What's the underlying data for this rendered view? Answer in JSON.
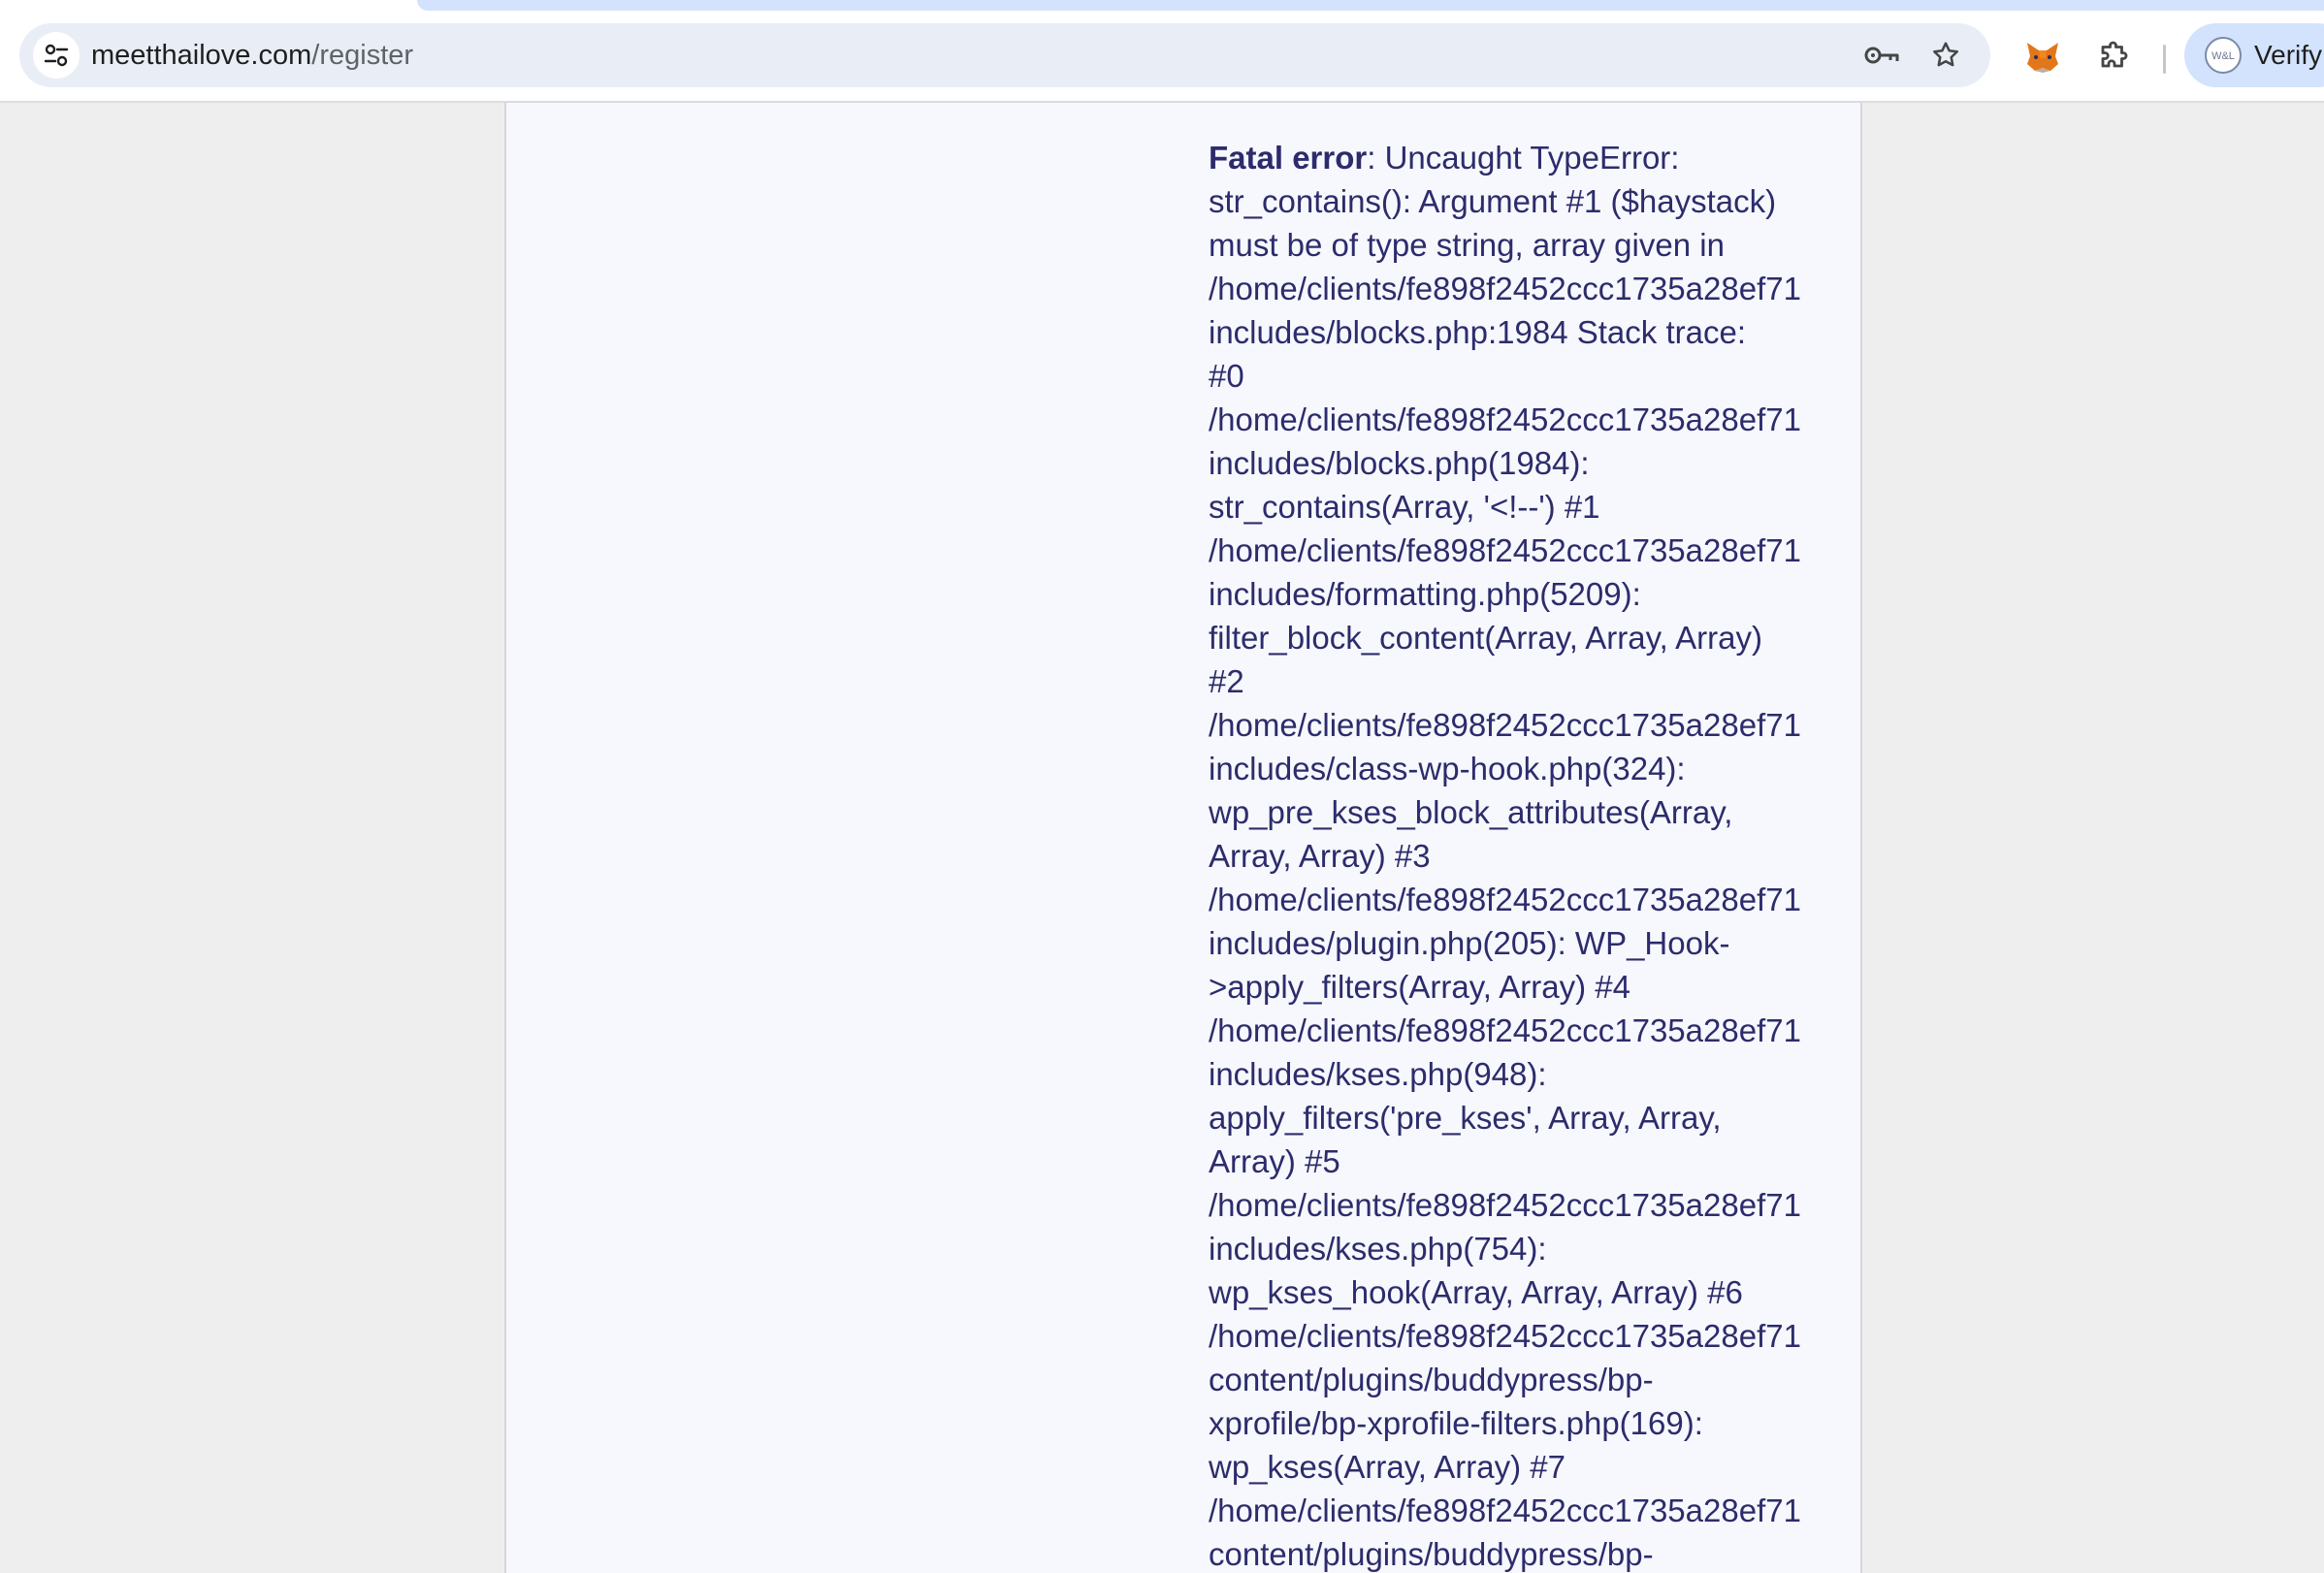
{
  "browser": {
    "url_host": "meetthailove.com",
    "url_path": "/register",
    "profile_label": "Verify",
    "profile_avatar_text": "W&L"
  },
  "icons": {
    "site_info": "tune-icon",
    "password": "key-icon",
    "bookmark": "star-icon",
    "metamask": "fox-icon",
    "extensions": "puzzle-icon"
  },
  "colors": {
    "error_text": "#2c2c6c",
    "page_bg": "#f7f8fd",
    "outer_bg": "#eeeeee",
    "omnibox_bg": "#e9eef6",
    "profile_chip_bg": "#d3e3fd"
  },
  "error": {
    "label": "Fatal error",
    "lines": [
      ": Uncaught TypeError:",
      "str_contains(): Argument #1 ($haystack)",
      "must be of type string, array given in",
      "/home/clients/fe898f2452ccc1735a28ef71",
      "includes/blocks.php:1984 Stack trace:",
      "#0",
      "/home/clients/fe898f2452ccc1735a28ef71",
      "includes/blocks.php(1984):",
      "str_contains(Array, '<!--') #1",
      "/home/clients/fe898f2452ccc1735a28ef71",
      "includes/formatting.php(5209):",
      "filter_block_content(Array, Array, Array)",
      "#2",
      "/home/clients/fe898f2452ccc1735a28ef71",
      "includes/class-wp-hook.php(324):",
      "wp_pre_kses_block_attributes(Array,",
      "Array, Array) #3",
      "/home/clients/fe898f2452ccc1735a28ef71",
      "includes/plugin.php(205): WP_Hook-",
      ">apply_filters(Array, Array) #4",
      "/home/clients/fe898f2452ccc1735a28ef71",
      "includes/kses.php(948):",
      "apply_filters('pre_kses', Array, Array,",
      "Array) #5",
      "/home/clients/fe898f2452ccc1735a28ef71",
      "includes/kses.php(754):",
      "wp_kses_hook(Array, Array, Array) #6",
      "/home/clients/fe898f2452ccc1735a28ef71",
      "content/plugins/buddypress/bp-",
      "xprofile/bp-xprofile-filters.php(169):",
      "wp_kses(Array, Array) #7",
      "/home/clients/fe898f2452ccc1735a28ef71",
      "content/plugins/buddypress/bp-"
    ]
  }
}
